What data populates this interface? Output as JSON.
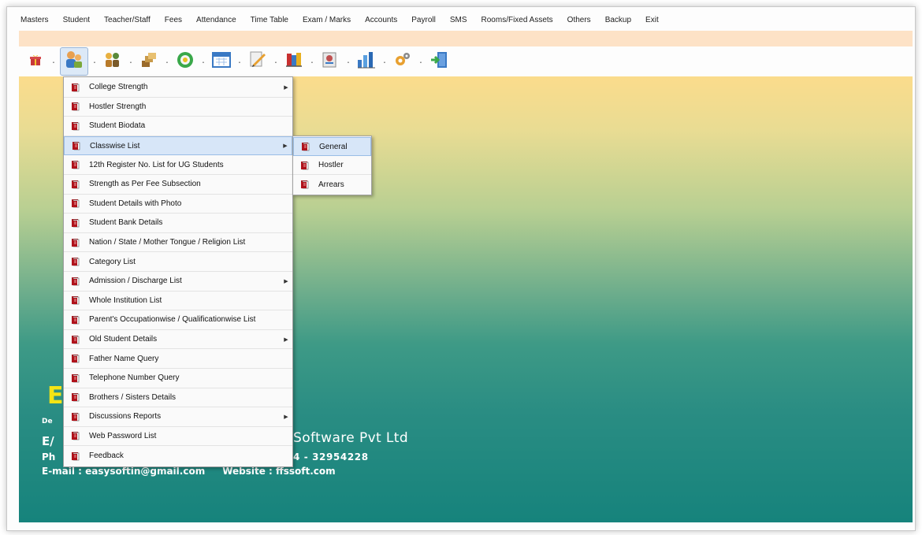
{
  "menubar": [
    "Masters",
    "Student",
    "Teacher/Staff",
    "Fees",
    "Attendance",
    "Time Table",
    "Exam / Marks",
    "Accounts",
    "Payroll",
    "SMS",
    "Rooms/Fixed Assets",
    "Others",
    "Backup",
    "Exit"
  ],
  "toolbar": {
    "icons": [
      "gift-icon",
      "students-icon",
      "people-icon",
      "coins-icon",
      "green-circle-icon",
      "calendar-icon",
      "pencil-icon",
      "books-icon",
      "card-icon",
      "chart-icon",
      "settings-icon",
      "exit-door-icon"
    ]
  },
  "menu": {
    "items": [
      {
        "label": "College Strength",
        "submenu": true
      },
      {
        "label": "Hostler Strength",
        "submenu": false
      },
      {
        "label": "Student Biodata",
        "submenu": false
      },
      {
        "label": "Classwise List",
        "submenu": true
      },
      {
        "label": "12th Register No. List for UG Students",
        "submenu": false
      },
      {
        "label": "Strength as Per Fee Subsection",
        "submenu": false
      },
      {
        "label": "Student Details with Photo",
        "submenu": false
      },
      {
        "label": "Student Bank Details",
        "submenu": false
      },
      {
        "label": "Nation / State / Mother Tongue / Religion List",
        "submenu": false
      },
      {
        "label": "Category List",
        "submenu": false
      },
      {
        "label": "Admission / Discharge List",
        "submenu": true
      },
      {
        "label": "Whole Institution List",
        "submenu": false
      },
      {
        "label": "Parent's Occupationwise / Qualificationwise  List",
        "submenu": false
      },
      {
        "label": "Old Student Details",
        "submenu": true
      },
      {
        "label": "Father Name Query",
        "submenu": false
      },
      {
        "label": "Telephone Number Query",
        "submenu": false
      },
      {
        "label": "Brothers / Sisters Details",
        "submenu": false
      },
      {
        "label": "Discussions Reports",
        "submenu": true
      },
      {
        "label": "Web Password List",
        "submenu": false
      },
      {
        "label": "Feedback",
        "submenu": false
      }
    ],
    "arrow": "▶"
  },
  "submenu": {
    "items": [
      {
        "label": "General"
      },
      {
        "label": "Hostler"
      },
      {
        "label": "Arrears"
      }
    ]
  },
  "brand": {
    "logo_letter": "E",
    "dev_prefix": "De",
    "company_prefix": "E/",
    "company_suffix": "Software Pvt Ltd",
    "phone_prefix": "Ph",
    "phone_suffix": "4 - 32954228",
    "email": "E-mail : easysoftin@gmail.com",
    "website": "Website : ffssoft.com"
  },
  "colors": {
    "menu_highlight": "#d7e6f8",
    "gradient_top": "#fbdc8c",
    "gradient_bottom": "#16837c",
    "logo_yellow": "#f4e414",
    "book_red": "#b0121b"
  }
}
